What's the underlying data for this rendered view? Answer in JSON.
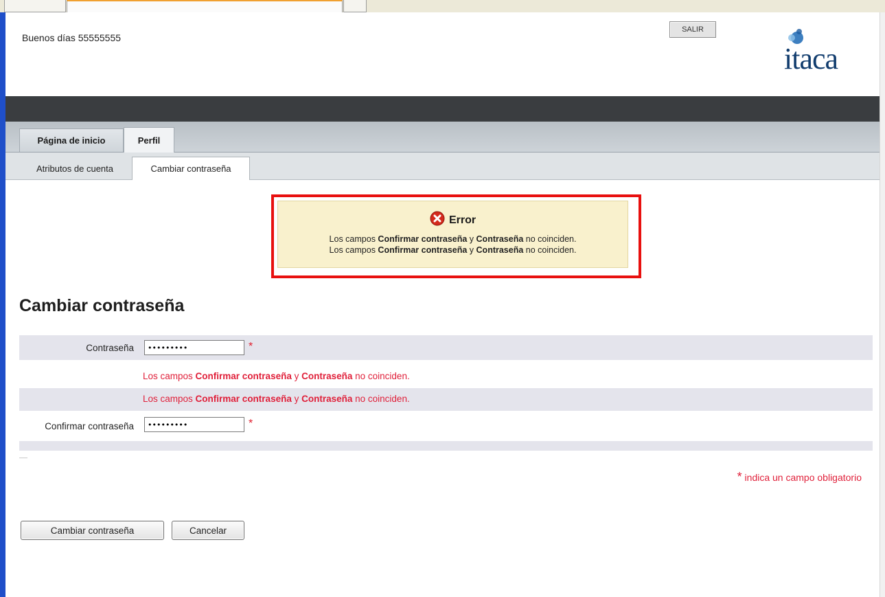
{
  "header": {
    "greeting": "Buenos días 55555555",
    "logout_label": "SALIR",
    "logo_text": "itaca"
  },
  "tabs": [
    {
      "label": "Página de inicio",
      "active": false
    },
    {
      "label": "Perfil",
      "active": true
    }
  ],
  "subtabs": [
    {
      "label": "Atributos de cuenta",
      "active": false
    },
    {
      "label": "Cambiar contraseña",
      "active": true
    }
  ],
  "error_box": {
    "title": "Error",
    "lines": [
      {
        "pre": "Los campos ",
        "field1": "Confirmar contraseña",
        "mid": " y ",
        "field2": "Contraseña",
        "post": " no coinciden."
      },
      {
        "pre": "Los campos ",
        "field1": "Confirmar contraseña",
        "mid": " y ",
        "field2": "Contraseña",
        "post": " no coinciden."
      }
    ]
  },
  "form": {
    "title": "Cambiar contraseña",
    "password": {
      "label": "Contraseña",
      "value": "•••••••••",
      "required_mark": "*"
    },
    "field_errors": [
      {
        "pre": "Los campos ",
        "field1": "Confirmar contraseña",
        "mid": " y ",
        "field2": "Contraseña",
        "post": " no coinciden."
      },
      {
        "pre": "Los campos ",
        "field1": "Confirmar contraseña",
        "mid": " y ",
        "field2": "Contraseña",
        "post": " no coinciden."
      }
    ],
    "confirm": {
      "label": "Confirmar contraseña",
      "value": "•••••••••",
      "required_mark": "*"
    },
    "required_note": {
      "mark": "*",
      "text": " indica un campo obligatorio"
    }
  },
  "buttons": {
    "submit_label": "Cambiar contraseña",
    "cancel_label": "Cancelar"
  },
  "colors": {
    "error_border": "#e8100f",
    "error_bg": "#f9f1cd",
    "error_text": "#e0203a",
    "dark_band": "#3a3d40",
    "row_shade": "#e4e4ec"
  },
  "icons": {
    "error": "error-x-icon",
    "logo_mark": "itaca-logo-icon"
  }
}
